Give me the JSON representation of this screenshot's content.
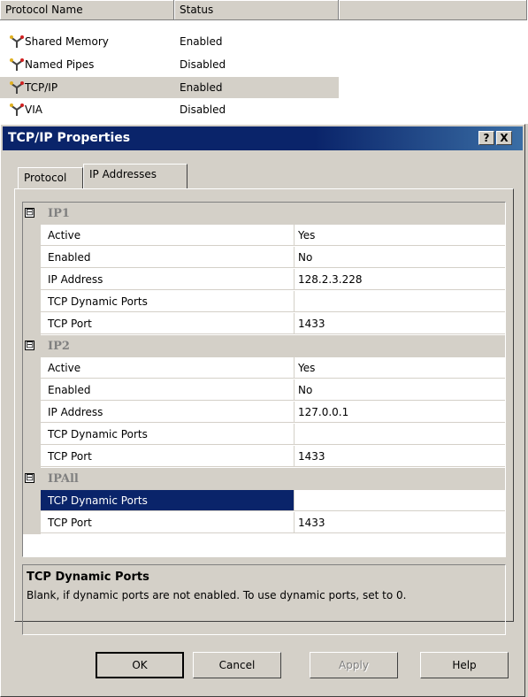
{
  "protocol_list": {
    "columns": [
      "Protocol Name",
      "Status"
    ],
    "rows": [
      {
        "name": "Shared Memory",
        "status": "Enabled"
      },
      {
        "name": "Named Pipes",
        "status": "Disabled"
      },
      {
        "name": "TCP/IP",
        "status": "Enabled"
      },
      {
        "name": "VIA",
        "status": "Disabled"
      }
    ],
    "selected_index": 2
  },
  "dialog": {
    "title": "TCP/IP Properties",
    "help_button": "?",
    "close_button": "X",
    "tabs": [
      {
        "label": "Protocol"
      },
      {
        "label": "IP Addresses"
      }
    ],
    "active_tab": "IP Addresses",
    "groups": [
      {
        "title": "IP1",
        "toggle": "⊟",
        "properties": [
          {
            "name": "Active",
            "value": "Yes"
          },
          {
            "name": "Enabled",
            "value": "No"
          },
          {
            "name": "IP Address",
            "value": "128.2.3.228"
          },
          {
            "name": "TCP Dynamic Ports",
            "value": ""
          },
          {
            "name": "TCP Port",
            "value": "1433"
          }
        ]
      },
      {
        "title": "IP2",
        "toggle": "⊟",
        "properties": [
          {
            "name": "Active",
            "value": "Yes"
          },
          {
            "name": "Enabled",
            "value": "No"
          },
          {
            "name": "IP Address",
            "value": "127.0.0.1"
          },
          {
            "name": "TCP Dynamic Ports",
            "value": ""
          },
          {
            "name": "TCP Port",
            "value": "1433"
          }
        ]
      },
      {
        "title": "IPAll",
        "toggle": "⊟",
        "properties": [
          {
            "name": "TCP Dynamic Ports",
            "value": ""
          },
          {
            "name": "TCP Port",
            "value": "1433"
          }
        ]
      }
    ],
    "description": {
      "title": "TCP Dynamic Ports",
      "text": "Blank, if dynamic ports are not enabled. To use dynamic ports, set to 0."
    },
    "buttons": {
      "ok": "OK",
      "cancel": "Cancel",
      "apply": "Apply",
      "help": "Help"
    }
  },
  "colors": {
    "title_bar": "#0a246a",
    "selection": "#0a246a",
    "face": "#d4d0c8"
  }
}
